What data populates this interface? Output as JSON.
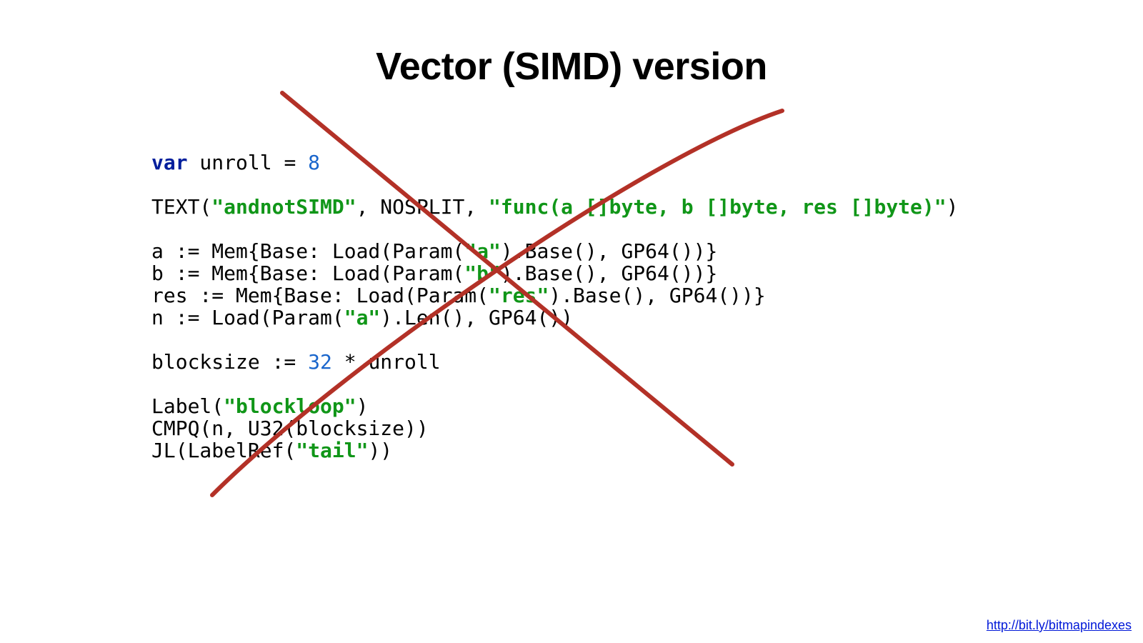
{
  "slide": {
    "title": "Vector (SIMD) version",
    "footer_link": "http://bit.ly/bitmapindexes"
  },
  "code": {
    "l1_kw": "var",
    "l1_rest": " unroll = ",
    "l1_num": "8",
    "l3_a": "TEXT(",
    "l3_s1": "\"andnotSIMD\"",
    "l3_b": ", NOSPLIT, ",
    "l3_s2": "\"func(a []byte, b []byte, res []byte)\"",
    "l3_c": ")",
    "l5_a": "a := Mem{Base: Load(Param(",
    "l5_s": "\"a\"",
    "l5_b": ").Base(), GP64())}",
    "l6_a": "b := Mem{Base: Load(Param(",
    "l6_s": "\"b\"",
    "l6_b": ").Base(), GP64())}",
    "l7_a": "res := Mem{Base: Load(Param(",
    "l7_s": "\"res\"",
    "l7_b": ").Base(), GP64())}",
    "l8_a": "n := Load(Param(",
    "l8_s": "\"a\"",
    "l8_b": ").Len(), GP64())",
    "l10_a": "blocksize := ",
    "l10_n": "32",
    "l10_b": " * unroll",
    "l12_a": "Label(",
    "l12_s": "\"blockloop\"",
    "l12_b": ")",
    "l13": "CMPQ(n, U32(blocksize))",
    "l14_a": "JL(LabelRef(",
    "l14_s": "\"tail\"",
    "l14_b": "))"
  }
}
